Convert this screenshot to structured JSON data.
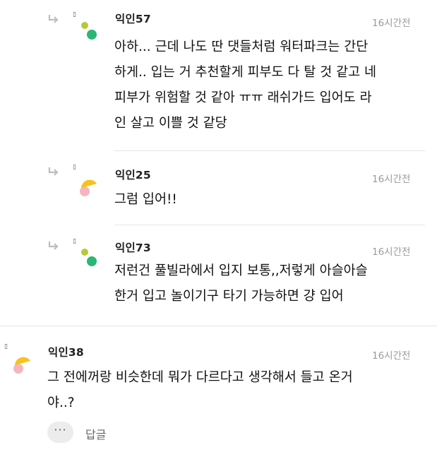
{
  "comments": [
    {
      "nickname": "익인57",
      "time": "16시간전",
      "marker": "▯",
      "text": "아하... 근데 나도 딴 댓들처럼 워터파크는 간단\n하게.. 입는 거 추천할게 피부도 다 탈 것 같고 네\n피부가 위험할 것 같아 ㅠㅠ 래쉬가드 입어도 라\n인 살고 이쁠 것 같당"
    },
    {
      "nickname": "익인25",
      "time": "16시간전",
      "marker": "▯",
      "text": "그럼 입어!!"
    },
    {
      "nickname": "익인73",
      "time": "16시간전",
      "marker": "▯",
      "text": "저런건 풀빌라에서 입지 보통,,저렇게 아슬아슬\n한거 입고 놀이기구 타기 가능하면 걍 입어"
    },
    {
      "nickname": "익인38",
      "time": "16시간전",
      "marker": "▯",
      "text": "그 전에꺼랑 비슷한데 뭐가 다르다고 생각해서 들고 온거\n야..?"
    }
  ],
  "actions": {
    "more_label": "···",
    "reply_label": "답글"
  },
  "colors": {
    "green_dot": "#2bb673",
    "olive_dot": "#b7c93a",
    "yellow": "#f7c21b",
    "pink": "#f4b6be"
  }
}
